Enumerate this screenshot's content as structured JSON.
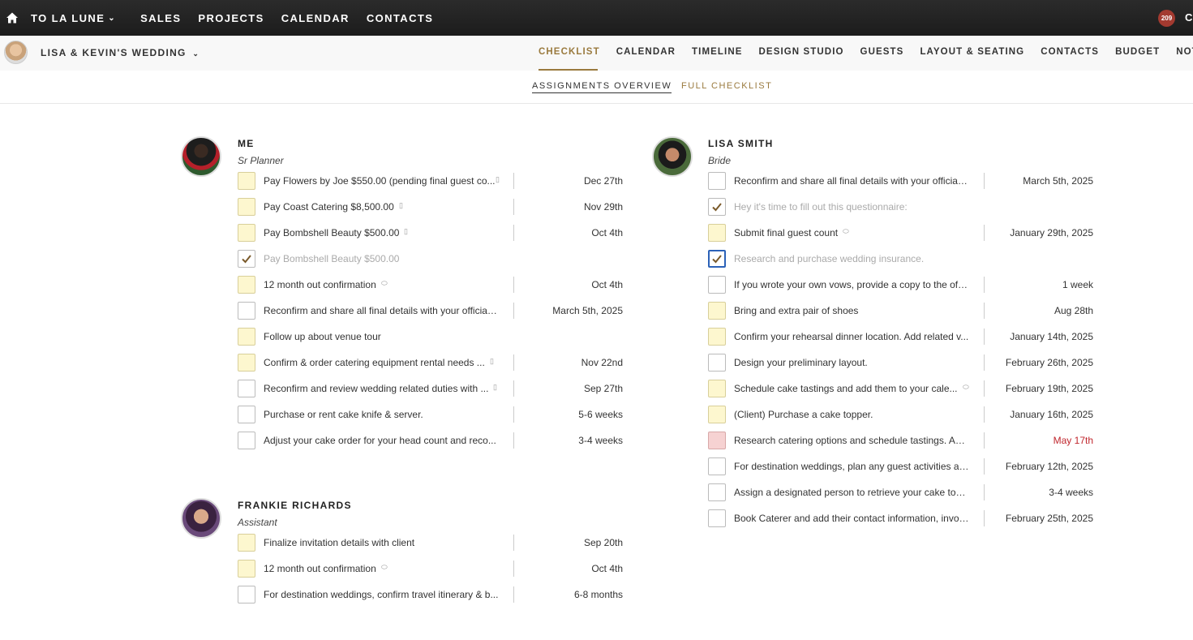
{
  "topbar": {
    "brand": "TO LA LUNE",
    "nav": [
      "SALES",
      "PROJECTS",
      "CALENDAR",
      "CONTACTS"
    ],
    "notifications": "209",
    "cut_label": "C"
  },
  "event": {
    "title": "LISA & KEVIN'S WEDDING",
    "tabs": [
      "CHECKLIST",
      "CALENDAR",
      "TIMELINE",
      "DESIGN STUDIO",
      "GUESTS",
      "LAYOUT & SEATING",
      "CONTACTS",
      "BUDGET",
      "NOTI"
    ]
  },
  "subtabs": [
    "ASSIGNMENTS OVERVIEW",
    "FULL CHECKLIST"
  ],
  "people": [
    {
      "name": "ME",
      "role": "Sr Planner",
      "tasks": [
        {
          "text": "Pay Flowers by Joe $550.00 (pending final guest co...",
          "date": "Dec 27th",
          "state": "yellow",
          "icon": "document-icon"
        },
        {
          "text": "Pay Coast Catering $8,500.00",
          "date": "Nov 29th",
          "state": "yellow",
          "icon": "document-icon"
        },
        {
          "text": "Pay Bombshell Beauty $500.00",
          "date": "Oct 4th",
          "state": "yellow",
          "icon": "document-icon"
        },
        {
          "text": "Pay Bombshell Beauty $500.00",
          "date": "",
          "state": "checked",
          "icon": ""
        },
        {
          "text": "12 month out confirmation",
          "date": "Oct 4th",
          "state": "yellow",
          "icon": "comment-icon"
        },
        {
          "text": "Reconfirm and share all final details with your offician...",
          "date": "March 5th, 2025",
          "state": "empty",
          "icon": ""
        },
        {
          "text": "Follow up about venue tour",
          "date": "",
          "state": "yellow",
          "icon": ""
        },
        {
          "text": "Confirm & order catering equipment rental needs ...",
          "date": "Nov 22nd",
          "state": "yellow",
          "icon": "document-icon"
        },
        {
          "text": "Reconfirm and review wedding related duties with ...",
          "date": "Sep 27th",
          "state": "empty",
          "icon": "document-icon"
        },
        {
          "text": "Purchase or rent cake knife & server.",
          "date": "5-6 weeks",
          "state": "empty",
          "icon": ""
        },
        {
          "text": "Adjust your cake order for your head count and reco...",
          "date": "3-4 weeks",
          "state": "empty",
          "icon": ""
        }
      ]
    },
    {
      "name": "FRANKIE RICHARDS",
      "role": "Assistant",
      "tasks": [
        {
          "text": "Finalize invitation details with client",
          "date": "Sep 20th",
          "state": "yellow",
          "icon": ""
        },
        {
          "text": "12 month out confirmation",
          "date": "Oct 4th",
          "state": "yellow",
          "icon": "comment-icon"
        },
        {
          "text": "For destination weddings, confirm travel itinerary & b...",
          "date": "6-8 months",
          "state": "empty",
          "icon": ""
        }
      ]
    },
    {
      "name": "LISA SMITH",
      "role": "Bride",
      "tasks": [
        {
          "text": "Reconfirm and share all final details with your offician...",
          "date": "March 5th, 2025",
          "state": "empty",
          "icon": ""
        },
        {
          "text": "Hey it's time to fill out this questionnaire:",
          "date": "",
          "state": "checked",
          "icon": ""
        },
        {
          "text": "Submit final guest count",
          "date": "January 29th, 2025",
          "state": "yellow",
          "icon": "comment-icon"
        },
        {
          "text": "Research and purchase wedding insurance.",
          "date": "",
          "state": "checked-blue",
          "icon": ""
        },
        {
          "text": "If you wrote your own vows, provide a copy to the offi...",
          "date": "1 week",
          "state": "empty",
          "icon": ""
        },
        {
          "text": "Bring and extra pair of shoes",
          "date": "Aug 28th",
          "state": "yellow",
          "icon": ""
        },
        {
          "text": "Confirm your rehearsal dinner location. Add related v...",
          "date": "January 14th, 2025",
          "state": "yellow",
          "icon": ""
        },
        {
          "text": "Design your preliminary layout.",
          "date": "February 26th, 2025",
          "state": "empty",
          "icon": ""
        },
        {
          "text": "Schedule cake tastings and add them to your cale...",
          "date": "February 19th, 2025",
          "state": "yellow",
          "icon": "comment-icon"
        },
        {
          "text": "(Client) Purchase a cake topper.",
          "date": "January 16th, 2025",
          "state": "yellow",
          "icon": ""
        },
        {
          "text": "Research catering options and schedule tastings. Add...",
          "date": "May 17th",
          "state": "red",
          "icon": ""
        },
        {
          "text": "For destination weddings, plan any guest activities an...",
          "date": "February 12th, 2025",
          "state": "empty",
          "icon": ""
        },
        {
          "text": "Assign a designated person to retrieve your cake top...",
          "date": "3-4 weeks",
          "state": "empty",
          "icon": ""
        },
        {
          "text": "Book Caterer and add their contact information, invoi...",
          "date": "February 25th, 2025",
          "state": "empty",
          "icon": ""
        }
      ]
    }
  ],
  "colors": {
    "accent": "#9a7a3e",
    "overdue": "#c0262d",
    "pending_box": "#fdf7cf",
    "overdue_box": "#f6d2d2"
  }
}
